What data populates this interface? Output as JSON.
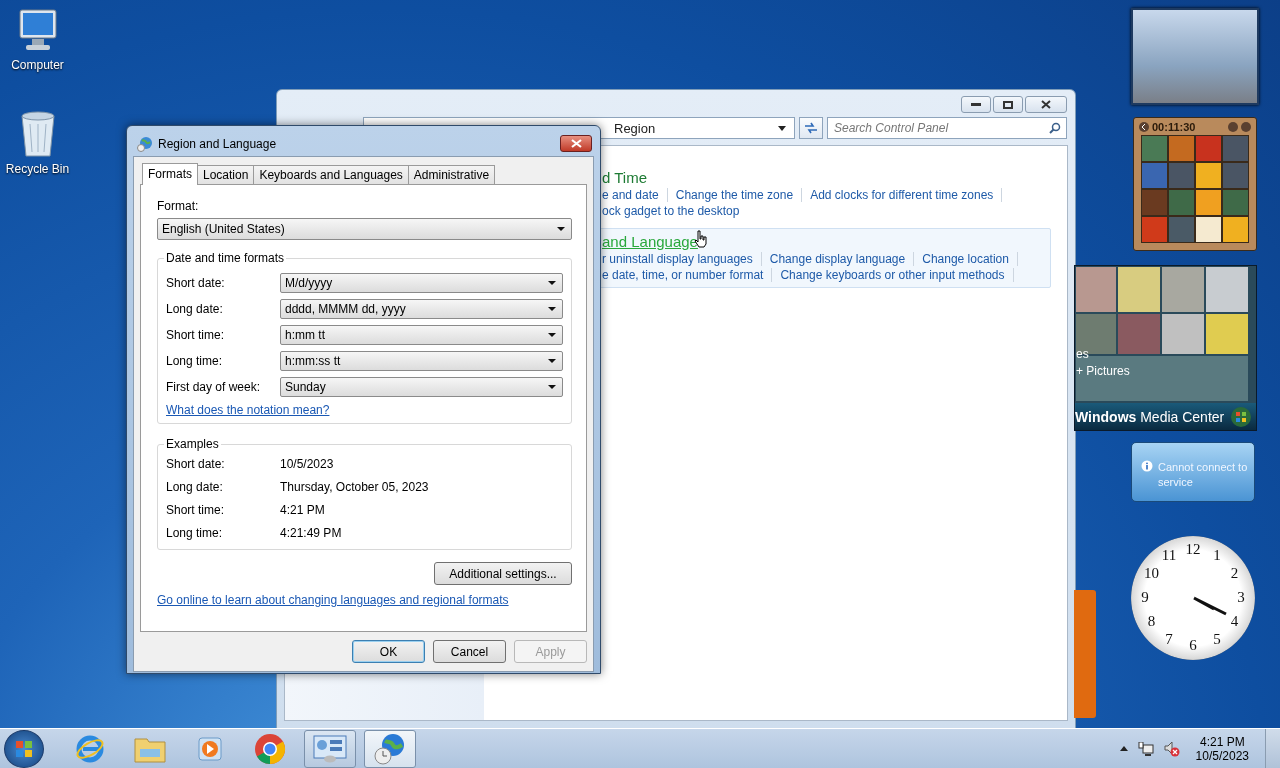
{
  "desktop_icons": [
    {
      "label": "Computer",
      "kind": "computer"
    },
    {
      "label": "Recycle Bin",
      "kind": "bin"
    }
  ],
  "control_panel": {
    "address": "Region",
    "search_placeholder": "Search Control Panel",
    "sections": [
      {
        "title": "d Time",
        "highlighted": false,
        "lines": [
          [
            "e and date",
            "Change the time zone",
            "Add clocks for different time zones"
          ],
          [
            "ock gadget to the desktop"
          ]
        ]
      },
      {
        "title": "and Language",
        "highlighted": true,
        "lines": [
          [
            "r uninstall display languages",
            "Change display language",
            "Change location"
          ],
          [
            "e date, time, or number format",
            "Change keyboards or other input methods"
          ]
        ]
      }
    ]
  },
  "dialog": {
    "title": "Region and Language",
    "tabs": [
      {
        "label": "Formats",
        "selected": true
      },
      {
        "label": "Location",
        "selected": false
      },
      {
        "label": "Keyboards and Languages",
        "selected": false
      },
      {
        "label": "Administrative",
        "selected": false
      }
    ],
    "format_label": "Format:",
    "format_value": "English (United States)",
    "formats_group": "Date and time formats",
    "fields": [
      {
        "label": "Short date:",
        "value": "M/d/yyyy"
      },
      {
        "label": "Long date:",
        "value": "dddd, MMMM dd, yyyy"
      },
      {
        "label": "Short time:",
        "value": "h:mm tt"
      },
      {
        "label": "Long time:",
        "value": "h:mm:ss tt"
      },
      {
        "label": "First day of week:",
        "value": "Sunday"
      }
    ],
    "notation_link": "What does the notation mean?",
    "examples_group": "Examples",
    "examples": [
      {
        "label": "Short date:",
        "value": "10/5/2023"
      },
      {
        "label": "Long date:",
        "value": "Thursday, October 05, 2023"
      },
      {
        "label": "Short time:",
        "value": "4:21 PM"
      },
      {
        "label": "Long time:",
        "value": "4:21:49 PM"
      }
    ],
    "additional_button": "Additional settings...",
    "online_link": "Go online to learn about changing languages and regional formats",
    "buttons": [
      {
        "label": "OK",
        "default": true,
        "disabled": false
      },
      {
        "label": "Cancel",
        "default": false,
        "disabled": false
      },
      {
        "label": "Apply",
        "default": false,
        "disabled": true
      }
    ]
  },
  "gadgets": {
    "puzzle_timer": "00:11:30",
    "media_lines": [
      "es",
      "+ Pictures"
    ],
    "media_title": "**Windows** Media Center",
    "weather_message": "Cannot connect to service",
    "clock_numerals": [
      "12",
      "1",
      "2",
      "3",
      "4",
      "5",
      "6",
      "7",
      "8",
      "9",
      "10",
      "11"
    ]
  },
  "taskbar": {
    "items": [
      {
        "kind": "ie",
        "open": false,
        "selected": false
      },
      {
        "kind": "explorer",
        "open": false,
        "selected": false
      },
      {
        "kind": "media",
        "open": false,
        "selected": false
      },
      {
        "kind": "chrome",
        "open": false,
        "selected": false
      },
      {
        "kind": "control",
        "open": true,
        "selected": false
      },
      {
        "kind": "region",
        "open": true,
        "selected": true
      }
    ],
    "time": "4:21 PM",
    "date": "10/5/2023"
  }
}
